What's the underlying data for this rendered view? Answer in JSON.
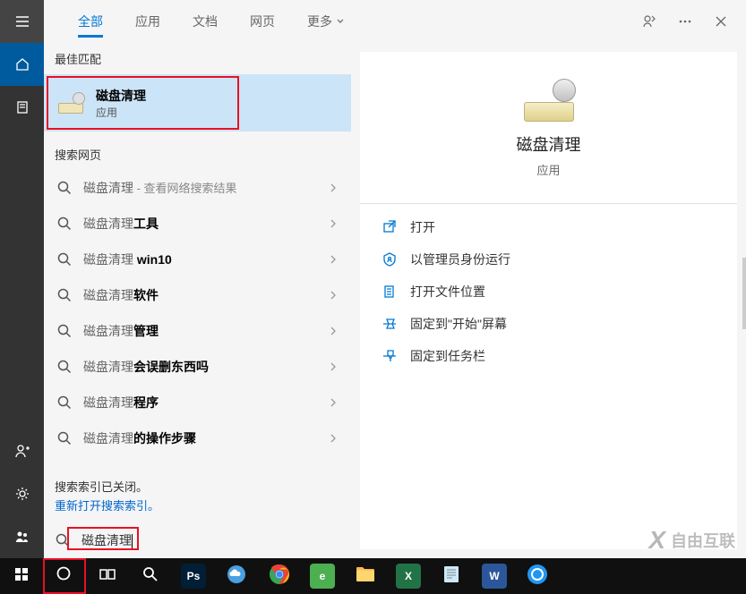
{
  "sidebar": {
    "items": [
      "menu",
      "home",
      "documents",
      "add-user",
      "settings",
      "people"
    ]
  },
  "tabs": {
    "items": [
      {
        "label": "全部",
        "active": true
      },
      {
        "label": "应用",
        "active": false
      },
      {
        "label": "文档",
        "active": false
      },
      {
        "label": "网页",
        "active": false
      }
    ],
    "more_label": "更多"
  },
  "sections": {
    "best_match": "最佳匹配",
    "web_search": "搜索网页"
  },
  "best_match": {
    "title": "磁盘清理",
    "subtitle": "应用"
  },
  "web_results": [
    {
      "prefix": "磁盘清理",
      "suffix": "",
      "extra": " - 查看网络搜索结果"
    },
    {
      "prefix": "磁盘清理",
      "suffix": "工具",
      "extra": ""
    },
    {
      "prefix": "磁盘清理 ",
      "suffix": "win10",
      "extra": ""
    },
    {
      "prefix": "磁盘清理",
      "suffix": "软件",
      "extra": ""
    },
    {
      "prefix": "磁盘清理",
      "suffix": "管理",
      "extra": ""
    },
    {
      "prefix": "磁盘清理",
      "suffix": "会误删东西吗",
      "extra": ""
    },
    {
      "prefix": "磁盘清理",
      "suffix": "程序",
      "extra": ""
    },
    {
      "prefix": "磁盘清理",
      "suffix": "的操作步骤",
      "extra": ""
    }
  ],
  "index": {
    "off_msg": "搜索索引已关闭。",
    "link": "重新打开搜索索引。"
  },
  "search_input": {
    "value": "磁盘清理"
  },
  "preview": {
    "title": "磁盘清理",
    "subtitle": "应用",
    "actions": [
      {
        "icon": "open",
        "label": "打开"
      },
      {
        "icon": "admin",
        "label": "以管理员身份运行"
      },
      {
        "icon": "folder",
        "label": "打开文件位置"
      },
      {
        "icon": "pin-start",
        "label": "固定到\"开始\"屏幕"
      },
      {
        "icon": "pin-taskbar",
        "label": "固定到任务栏"
      }
    ]
  },
  "taskbar": {
    "items": [
      {
        "name": "start",
        "color": "",
        "label": ""
      },
      {
        "name": "search",
        "color": "",
        "label": "",
        "highlighted": true
      },
      {
        "name": "taskview",
        "color": "",
        "label": ""
      },
      {
        "name": "magnify",
        "color": "",
        "label": ""
      },
      {
        "name": "photoshop",
        "color": "#001e36",
        "label": "Ps"
      },
      {
        "name": "cloud",
        "color": "",
        "label": ""
      },
      {
        "name": "chrome",
        "color": "",
        "label": ""
      },
      {
        "name": "360",
        "color": "#4caf50",
        "label": "e"
      },
      {
        "name": "explorer",
        "color": "",
        "label": ""
      },
      {
        "name": "excel",
        "color": "#217346",
        "label": "X"
      },
      {
        "name": "notepad",
        "color": "",
        "label": ""
      },
      {
        "name": "word",
        "color": "#2b579a",
        "label": "W"
      },
      {
        "name": "browser",
        "color": "",
        "label": ""
      }
    ]
  },
  "watermark": {
    "text": "自由互联"
  }
}
